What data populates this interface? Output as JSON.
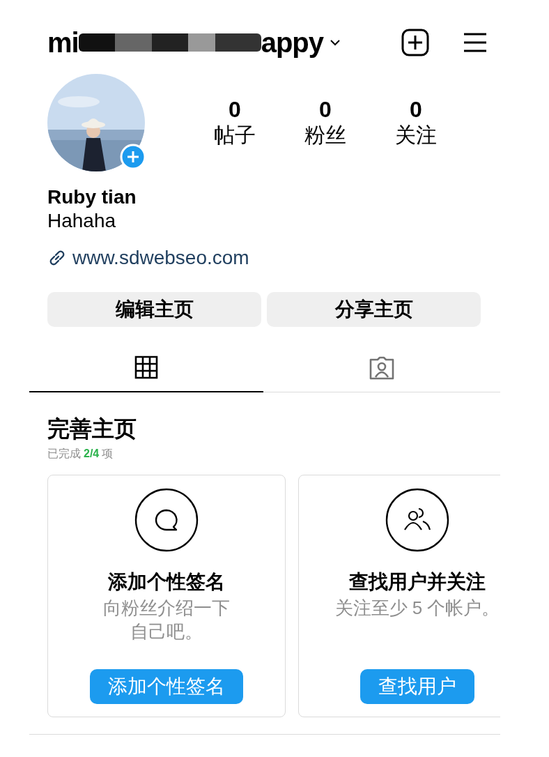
{
  "header": {
    "username_start": "mi",
    "username_end": "appy"
  },
  "profile": {
    "stats": [
      {
        "value": "0",
        "label": "帖子"
      },
      {
        "value": "0",
        "label": "粉丝"
      },
      {
        "value": "0",
        "label": "关注"
      }
    ],
    "name": "Ruby tian",
    "bio": "Hahaha",
    "link": "www.sdwebseo.com"
  },
  "actions": [
    "编辑主页",
    "分享主页"
  ],
  "tabs": [
    {
      "kind": "grid",
      "selected": true
    },
    {
      "kind": "tagged",
      "selected": false
    }
  ],
  "completion": {
    "title": "完善主页",
    "progress_prefix": "已完成",
    "progress_count": "2/4",
    "progress_suffix": "项",
    "cards": [
      {
        "kind": "chat",
        "title": "添加个性签名",
        "description": [
          "向粉丝介绍一下",
          "自己吧。"
        ],
        "button": "添加个性签名"
      },
      {
        "kind": "people",
        "title": "查找用户并关注",
        "description": [
          "关注至少 5 个帐户。"
        ],
        "button": "查找用户"
      }
    ]
  }
}
